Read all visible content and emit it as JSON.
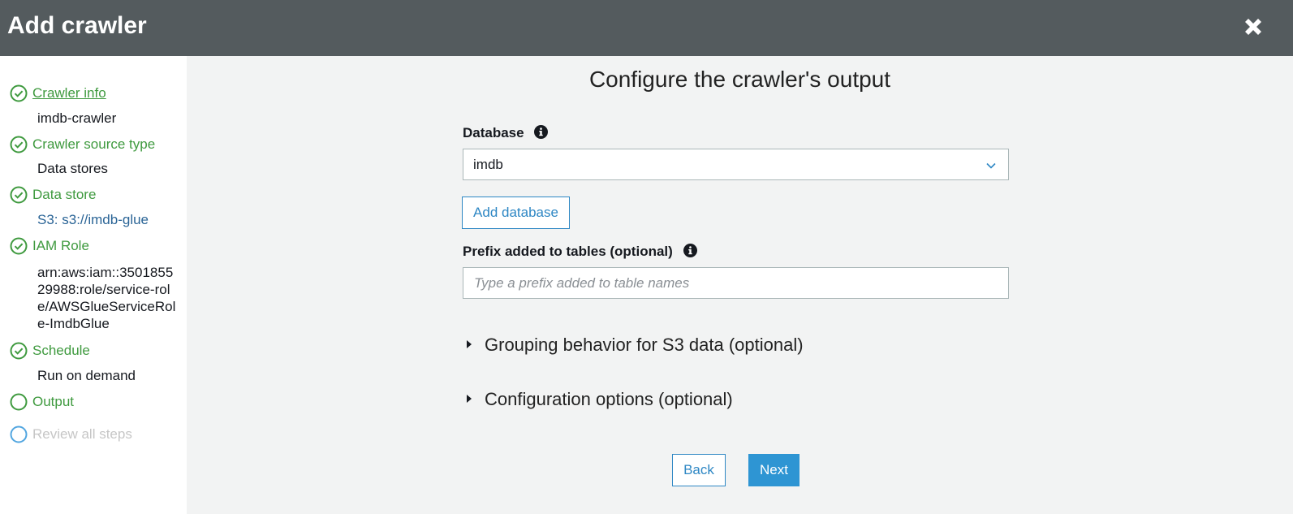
{
  "header": {
    "title": "Add crawler"
  },
  "sidebar": {
    "steps": [
      {
        "label": "Crawler info",
        "value": "imdb-crawler",
        "status": "complete",
        "icon": "check-circle-icon"
      },
      {
        "label": "Crawler source type",
        "value": "Data stores",
        "status": "complete",
        "icon": "check-circle-icon"
      },
      {
        "label": "Data store",
        "value": "S3: s3://imdb-glue",
        "status": "complete",
        "icon": "check-circle-icon"
      },
      {
        "label": "IAM Role",
        "value": "arn:aws:iam::350185529988:role/service-role/AWSGlueServiceRole-ImdbGlue",
        "status": "complete",
        "icon": "check-circle-icon"
      },
      {
        "label": "Schedule",
        "value": "Run on demand",
        "status": "complete",
        "icon": "check-circle-icon"
      },
      {
        "label": "Output",
        "status": "current",
        "icon": "circle-icon"
      },
      {
        "label": "Review all steps",
        "status": "disabled",
        "icon": "circle-icon"
      }
    ]
  },
  "main": {
    "heading": "Configure the crawler's output",
    "database": {
      "label": "Database",
      "selected": "imdb"
    },
    "add_database_label": "Add database",
    "prefix": {
      "label": "Prefix added to tables (optional)",
      "value": "",
      "placeholder": "Type a prefix added to table names"
    },
    "sections": [
      {
        "label": "Grouping behavior for S3 data (optional)",
        "expanded": false
      },
      {
        "label": "Configuration options (optional)",
        "expanded": false
      }
    ],
    "back_label": "Back",
    "next_label": "Next"
  },
  "colors": {
    "header_bg": "#545b5e",
    "complete_green": "#3f9a3f",
    "primary_blue": "#2e95d3",
    "link_blue": "#2e87c4",
    "disabled_gray": "#c6c6c6",
    "pending_circle": "#52a6e0"
  }
}
